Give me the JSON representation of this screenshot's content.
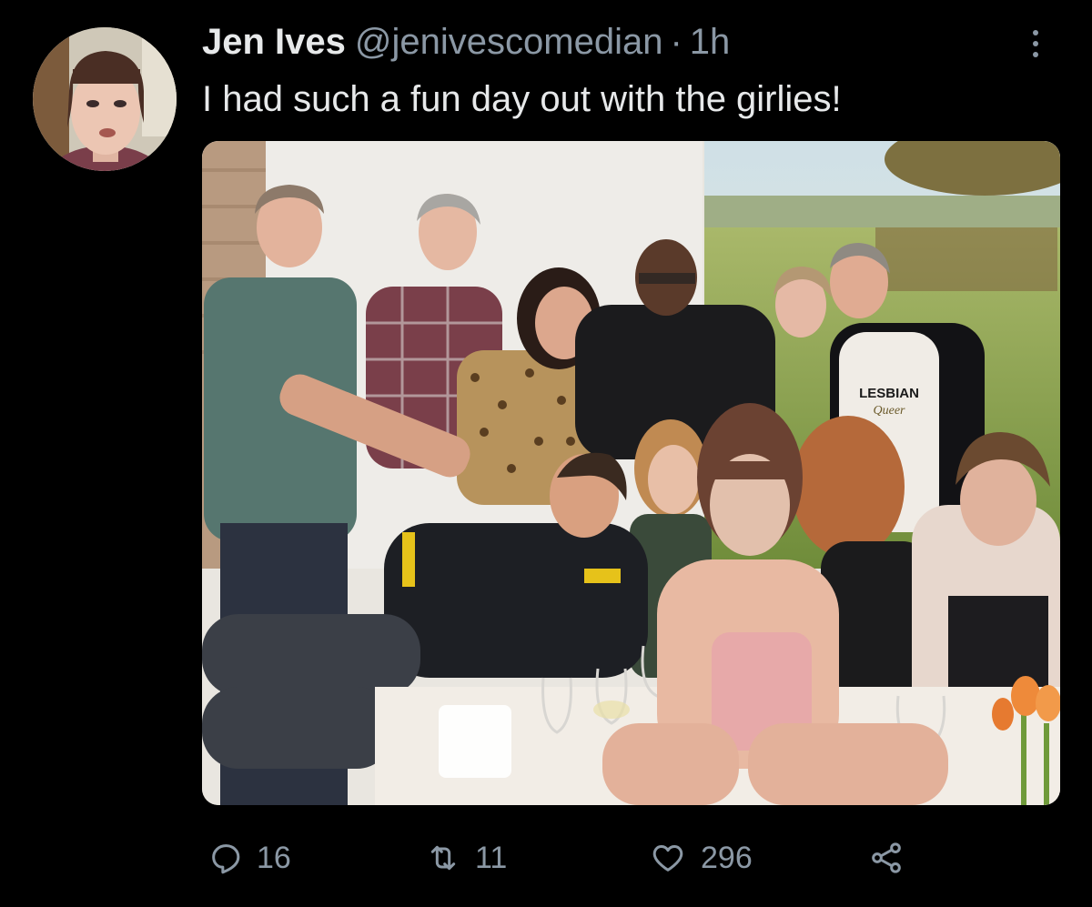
{
  "tweet": {
    "author": {
      "display_name": "Jen Ives",
      "handle": "@jenivescomedian",
      "separator": "·",
      "time": "1h"
    },
    "text": "I had such a fun day out with the girlies!",
    "media": {
      "shirt_text_line1": "LESBIAN",
      "shirt_text_line2": "Queer"
    },
    "stats": {
      "replies": "16",
      "retweets": "11",
      "likes": "296"
    },
    "icons": {
      "reply": "reply-icon",
      "retweet": "retweet-icon",
      "like": "heart-icon",
      "share": "share-icon",
      "more": "more-icon"
    }
  },
  "colors": {
    "background": "#000000",
    "primary_text": "#e7e9ea",
    "secondary_text": "#8b98a5"
  }
}
